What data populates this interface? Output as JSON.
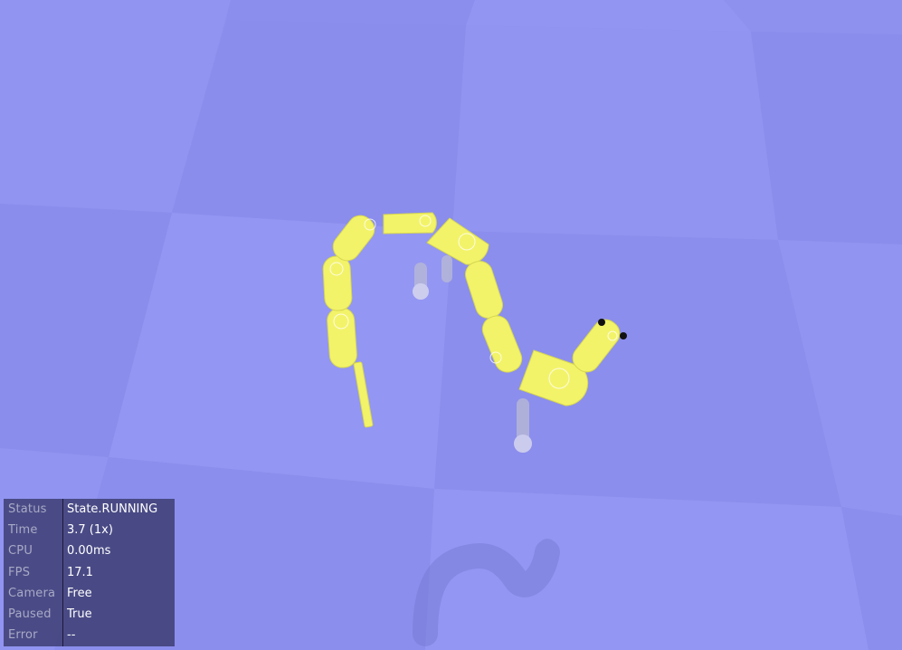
{
  "scene": {
    "background_color": "#8e91ee",
    "floor_tile_light": "#9497f2",
    "floor_tile_dark": "#8689ea",
    "robot_color": "#f3f36a",
    "robot_shadow": "#d9d94e",
    "robot_description": "yellow snake robot (segmented) on checkered floor with faint reflection"
  },
  "status_panel": {
    "rows": [
      {
        "key": "Status",
        "value": "State.RUNNING"
      },
      {
        "key": "Time",
        "value": "3.7 (1x)"
      },
      {
        "key": "CPU",
        "value": "0.00ms"
      },
      {
        "key": "FPS",
        "value": "17.1"
      },
      {
        "key": "Camera",
        "value": "Free"
      },
      {
        "key": "Paused",
        "value": "True"
      },
      {
        "key": "Error",
        "value": "--"
      }
    ]
  }
}
